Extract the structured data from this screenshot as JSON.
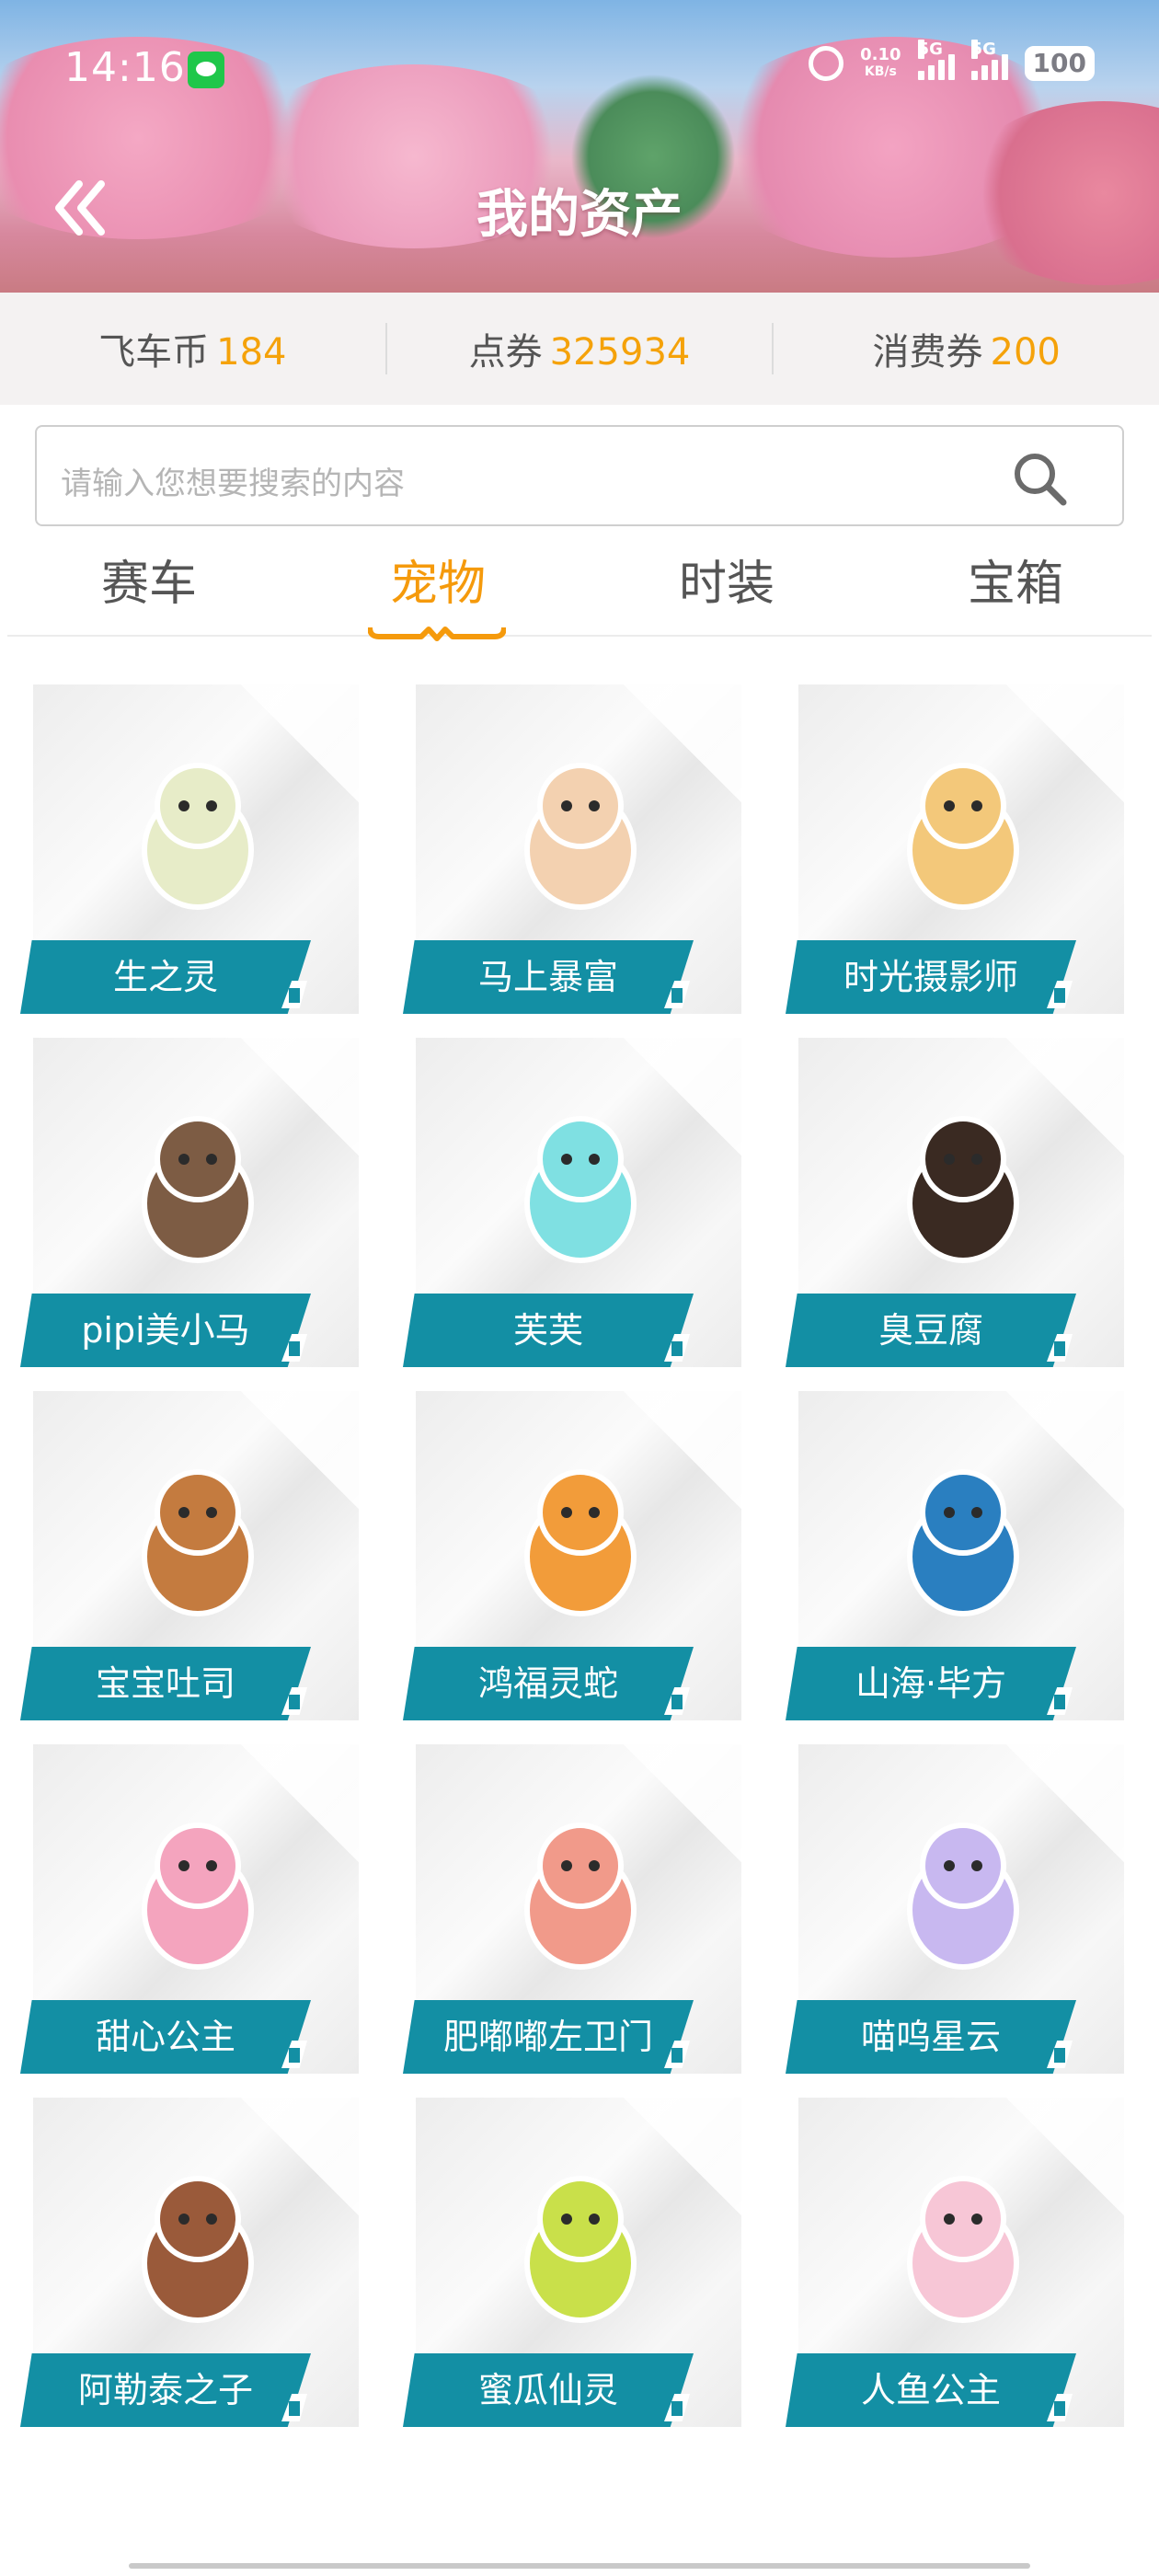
{
  "status_bar": {
    "time": "14:16",
    "net_speed": "0.10",
    "net_unit": "KB/s",
    "signal1": "5G",
    "signal2": "5G",
    "battery": "100"
  },
  "header": {
    "title": "我的资产"
  },
  "currency": [
    {
      "label": "飞车币",
      "value": "184"
    },
    {
      "label": "点券",
      "value": "325934"
    },
    {
      "label": "消费券",
      "value": "200"
    }
  ],
  "search": {
    "placeholder": "请输入您想要搜索的内容"
  },
  "tabs": [
    {
      "label": "赛车",
      "active": false
    },
    {
      "label": "宠物",
      "active": true
    },
    {
      "label": "时装",
      "active": false
    },
    {
      "label": "宝箱",
      "active": false
    }
  ],
  "pets": [
    {
      "name": "生之灵",
      "icon": "pet-shengzhiling-icon",
      "color": "#e7ecc8"
    },
    {
      "name": "马上暴富",
      "icon": "pet-mashangbaofu-icon",
      "color": "#f3d1b0"
    },
    {
      "name": "时光摄影师",
      "icon": "pet-shiguangsheyingshi-icon",
      "color": "#f3c87a"
    },
    {
      "name": "pipi美小马",
      "icon": "pet-pipimeixiaoma-icon",
      "color": "#7d5c44"
    },
    {
      "name": "芙芙",
      "icon": "pet-fufu-icon",
      "color": "#7fe0e2"
    },
    {
      "name": "臭豆腐",
      "icon": "pet-choudoufu-icon",
      "color": "#3a2a22"
    },
    {
      "name": "宝宝吐司",
      "icon": "pet-baobaotusi-icon",
      "color": "#c47b3f"
    },
    {
      "name": "鸿福灵蛇",
      "icon": "pet-hongfulingshe-icon",
      "color": "#f29c3a"
    },
    {
      "name": "山海·毕方",
      "icon": "pet-shanhaibifang-icon",
      "color": "#2a7fc0"
    },
    {
      "name": "甜心公主",
      "icon": "pet-tianxingongzhu-icon",
      "color": "#f4a4be"
    },
    {
      "name": "肥嘟嘟左卫门",
      "icon": "pet-feidudu-icon",
      "color": "#f19a8a"
    },
    {
      "name": "喵呜星云",
      "icon": "pet-miaowuxingyun-icon",
      "color": "#c8b8f0"
    },
    {
      "name": "阿勒泰之子",
      "icon": "pet-aletaizhizi-icon",
      "color": "#9a5a3a"
    },
    {
      "name": "蜜瓜仙灵",
      "icon": "pet-miguaxianling-icon",
      "color": "#c9e04a"
    },
    {
      "name": "人鱼公主",
      "icon": "pet-renyugongzhu-icon",
      "color": "#f7c6d6"
    }
  ]
}
